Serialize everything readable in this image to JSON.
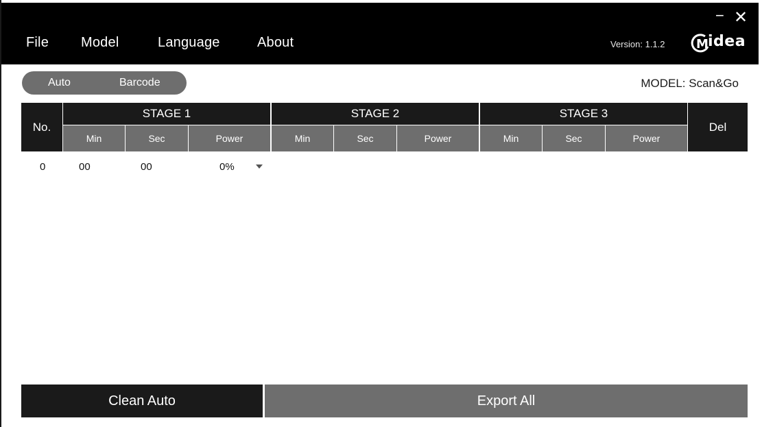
{
  "window": {
    "minimize_glyph": "−",
    "close_glyph": "✕"
  },
  "menu": {
    "file": "File",
    "model": "Model",
    "language": "Language",
    "about": "About"
  },
  "version": "Version: 1.1.2",
  "brand": {
    "text": "idea",
    "mark": "M"
  },
  "mode_toggle": {
    "auto": "Auto",
    "barcode": "Barcode"
  },
  "model_label": "MODEL: Scan&Go",
  "table": {
    "no_header": "No.",
    "del_header": "Del",
    "stages": [
      {
        "title": "STAGE 1",
        "min": "Min",
        "sec": "Sec",
        "power": "Power"
      },
      {
        "title": "STAGE 2",
        "min": "Min",
        "sec": "Sec",
        "power": "Power"
      },
      {
        "title": "STAGE 3",
        "min": "Min",
        "sec": "Sec",
        "power": "Power"
      }
    ],
    "rows": [
      {
        "no": "0",
        "min": "00",
        "sec": "00",
        "power": "0%"
      }
    ]
  },
  "buttons": {
    "clean": "Clean Auto",
    "export": "Export All"
  }
}
